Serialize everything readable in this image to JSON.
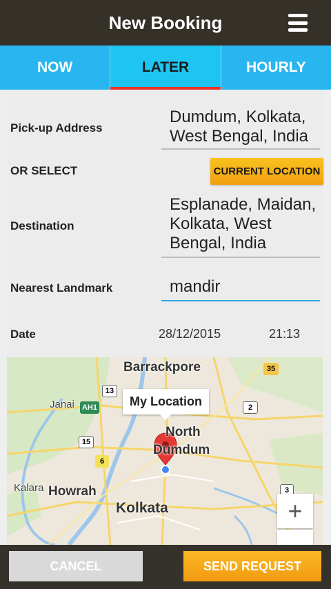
{
  "header": {
    "title": "New Booking",
    "menu_icon": "hamburger-menu-icon"
  },
  "tabs": [
    {
      "label": "NOW",
      "active": false
    },
    {
      "label": "LATER",
      "active": true
    },
    {
      "label": "HOURLY",
      "active": false
    }
  ],
  "form": {
    "pickup": {
      "label": "Pick-up Address",
      "value_line1": "Dumdum, Kolkata,",
      "value_line2": "West Bengal, India"
    },
    "or_select": {
      "label": "OR SELECT",
      "button_label": "CURRENT LOCATION"
    },
    "destination": {
      "label": "Destination",
      "value_line1": "Esplanade, Maidan,",
      "value_line2": "Kolkata, West",
      "value_line3": "Bengal, India"
    },
    "landmark": {
      "label": "Nearest Landmark",
      "value": "mandir"
    },
    "date": {
      "label": "Date",
      "date_value": "28/12/2015",
      "time_value": "21:13"
    }
  },
  "map": {
    "tooltip": "My Location",
    "places": {
      "barrackpore": "Barrackpore",
      "janai": "Janai",
      "north": "North",
      "dumdum": "Dumdum",
      "kalara": "Kalara",
      "howrah": "Howrah",
      "kolkata": "Kolkata"
    },
    "shields": {
      "s35": "35",
      "s13": "13",
      "ah1": "AH1",
      "s2": "2",
      "s15": "15",
      "s6": "6",
      "s3": "3"
    },
    "zoom_in_label": "+",
    "pin_color": "#e53935",
    "dot_color": "#4285f4"
  },
  "footer": {
    "cancel_label": "CANCEL",
    "send_label": "SEND REQUEST"
  },
  "colors": {
    "tab_bg": "#29b5ef",
    "active_tab_bg": "#1ec5f3",
    "accent_red": "#e8322a",
    "button_orange": "#f5a815",
    "header_bg": "#353129"
  }
}
